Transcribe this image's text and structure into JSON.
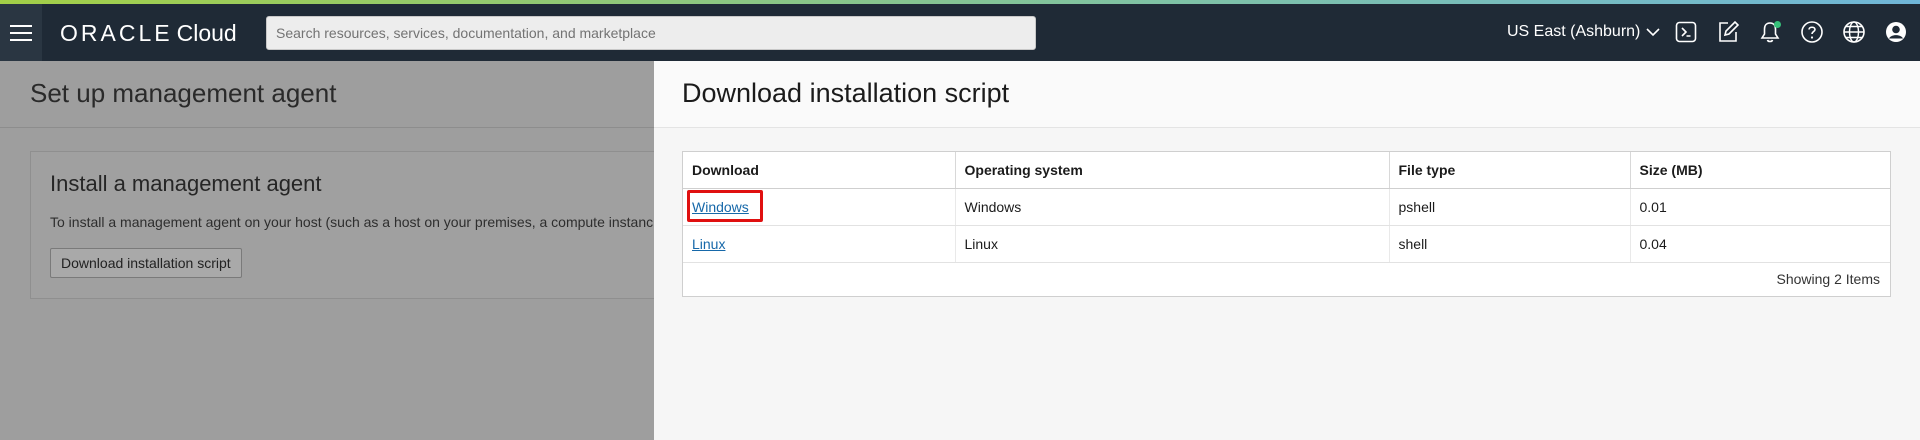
{
  "header": {
    "brand_word": "ORACLE",
    "brand_product": "Cloud",
    "search_placeholder": "Search resources, services, documentation, and marketplace",
    "region": "US East (Ashburn)",
    "icons": [
      "menu-icon",
      "cloud-shell-icon",
      "edit-icon",
      "bell-icon",
      "help-icon",
      "globe-icon",
      "user-icon"
    ],
    "notification_dot_color": "#37c17a"
  },
  "background_page": {
    "title": "Set up management agent",
    "card": {
      "title": "Install a management agent",
      "text": "To install a management agent on your host (such as a host on your premises, a compute instanc",
      "button": "Download installation script"
    }
  },
  "drawer": {
    "title": "Download installation script",
    "table": {
      "columns": [
        "Download",
        "Operating system",
        "File type",
        "Size (MB)"
      ],
      "rows": [
        {
          "download": "Windows",
          "os": "Windows",
          "type": "pshell",
          "size": "0.01"
        },
        {
          "download": "Linux",
          "os": "Linux",
          "type": "shell",
          "size": "0.04"
        }
      ],
      "footer": "Showing 2 Items"
    }
  },
  "colors": {
    "header_bg": "#1f2a36",
    "link": "#1668a9",
    "highlight": "#e01010"
  }
}
